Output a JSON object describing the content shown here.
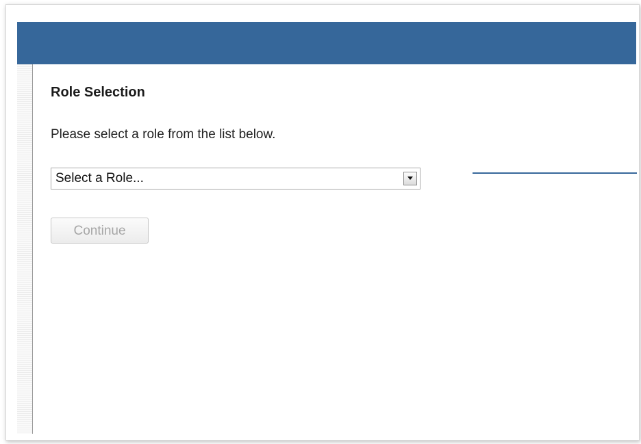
{
  "page": {
    "title": "Role Selection",
    "instructions": "Please select a role from the list below."
  },
  "role_select": {
    "selected_value": "Select a Role..."
  },
  "continue_button": {
    "label": "Continue",
    "state": "disabled"
  },
  "colors": {
    "header_bar": "#36679a",
    "callout_line": "#36679a",
    "disabled_text": "#a6a6a6"
  },
  "icons": {
    "select_arrow": "chevron-down-icon"
  }
}
